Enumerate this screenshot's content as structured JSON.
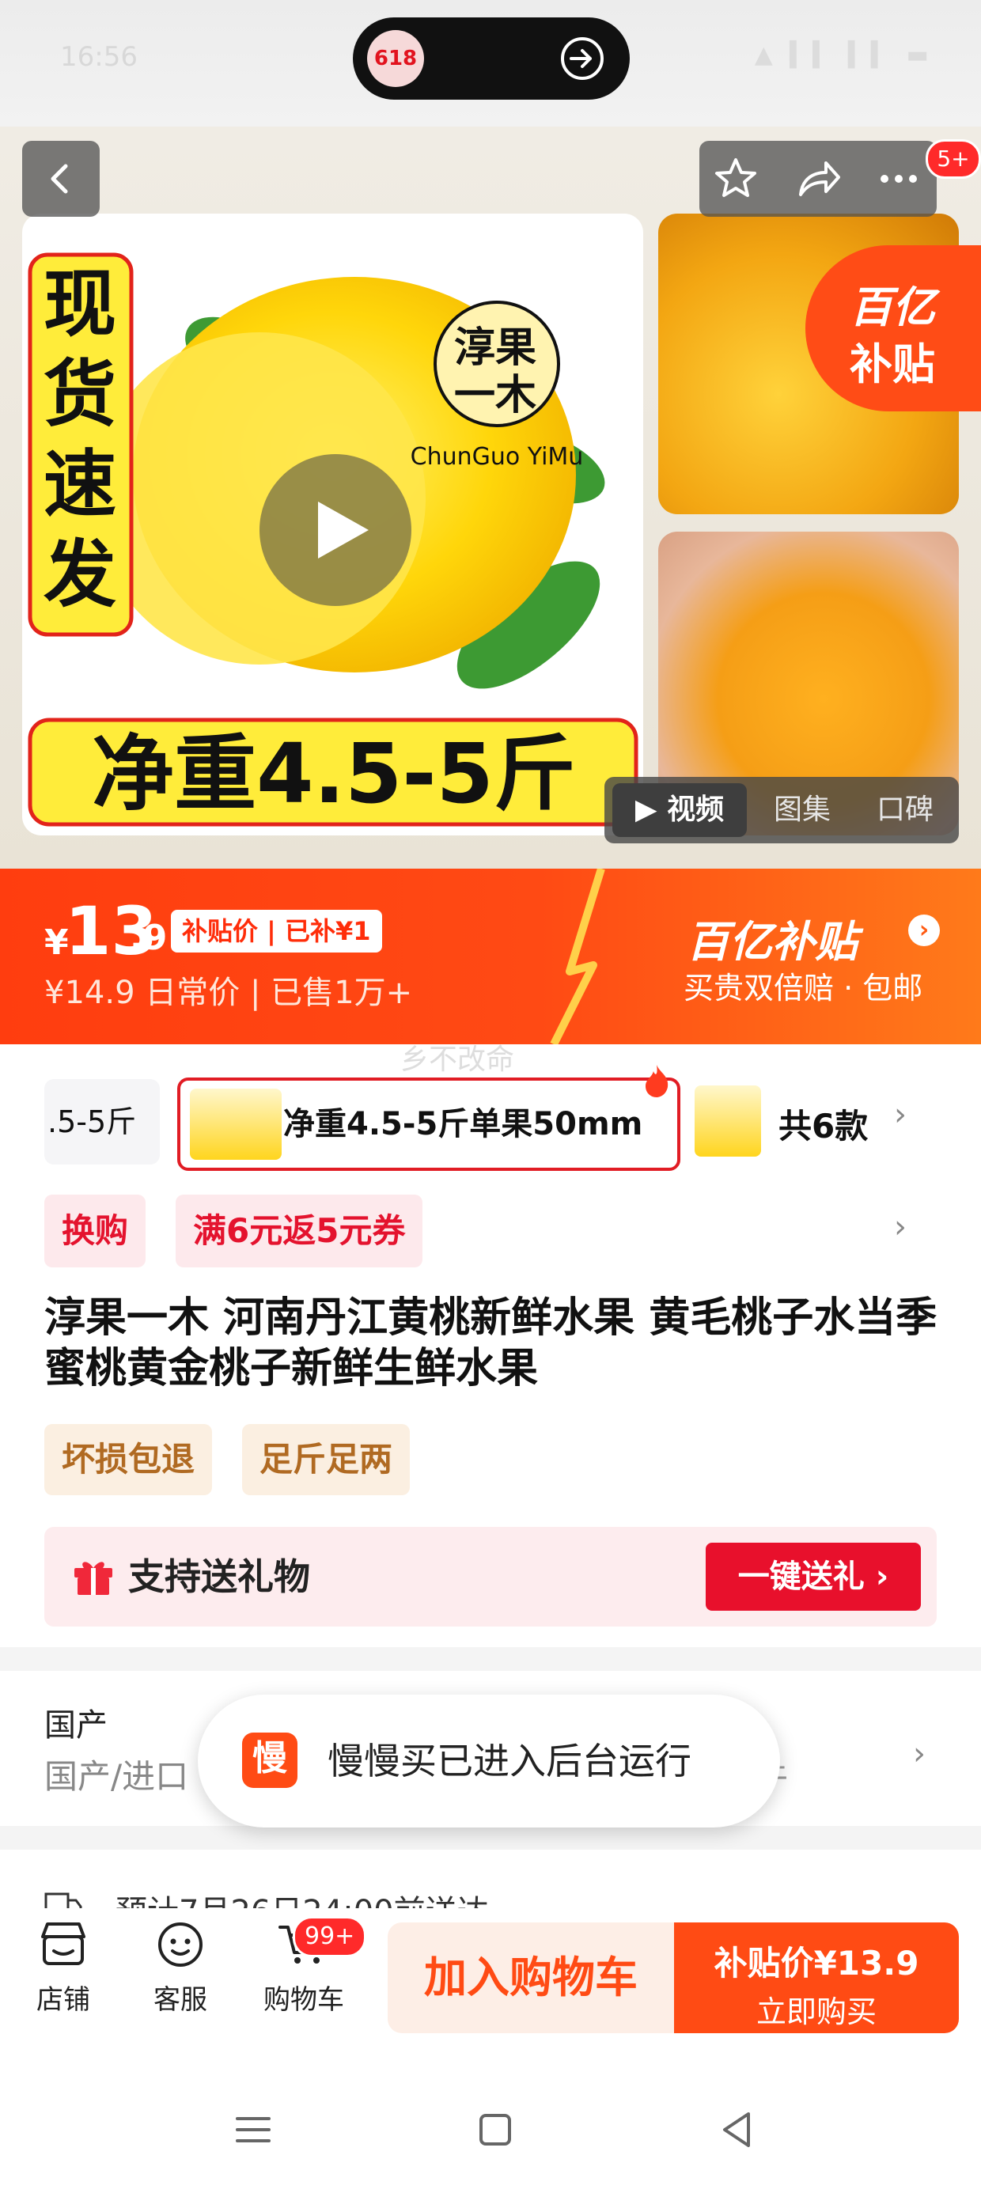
{
  "status": {
    "time": "16:56",
    "icons": "▲ ▍▍ ▍▍ ▬"
  },
  "pill": {
    "logo_text": "618"
  },
  "top_badge": "5+",
  "gallery": {
    "main_image_text_vertical": "现货速发",
    "main_image_weight": "净重4.5-5斤",
    "brand_cn": "淳果一木",
    "brand_en": "ChunGuo YiMu",
    "subsidy_corner_line1": "百亿",
    "subsidy_corner_line2": "补贴",
    "tabs": [
      "▶ 视频",
      "图集",
      "口碑"
    ]
  },
  "price": {
    "yen": "¥",
    "int": "13",
    "dec": ".9",
    "tag": "补贴价 | 已补¥1",
    "original": "¥14.9  日常价 | 已售1万+",
    "program_title": "百亿补贴",
    "program_arrow": "›",
    "program_sub": "买贵双倍赔 · 包邮"
  },
  "watermark": "乡不改命",
  "spec": {
    "left_partial": ".5-5斤",
    "selected_label": "净重4.5-5斤单果50mm",
    "count": "共6款",
    "chevron": "›"
  },
  "promos": [
    "换购",
    "满6元返5元券"
  ],
  "promo_chevron": "›",
  "product_title": "淳果一木 河南丹江黄桃新鲜水果 黄毛桃子水当季蜜桃黄金桃子新鲜生鲜水果",
  "guarantees": [
    "坏损包退",
    "足斤足两"
  ],
  "gift": {
    "label": "支持送礼物",
    "button": "一键送礼 ›"
  },
  "origin": {
    "title": "国产",
    "subtitle": "国产/进口",
    "subtitle_tail": "牛",
    "chevron": "›"
  },
  "toast": {
    "icon_text": "慢",
    "text": "慢慢买已进入后台运行"
  },
  "delivery": "预计7月26日24:00前送达",
  "bottom_nav": [
    {
      "label": "店铺",
      "icon": "shop-icon"
    },
    {
      "label": "客服",
      "icon": "service-icon"
    },
    {
      "label": "购物车",
      "icon": "cart-icon"
    }
  ],
  "cart_badge": "99+",
  "actions": {
    "add_cart": "加入购物车",
    "buy_price": "补贴价¥13.9",
    "buy_label": "立即购买"
  },
  "colors": {
    "accent": "#ff4b14",
    "red": "#e8102c",
    "price_bar": "#ff3d0f"
  }
}
